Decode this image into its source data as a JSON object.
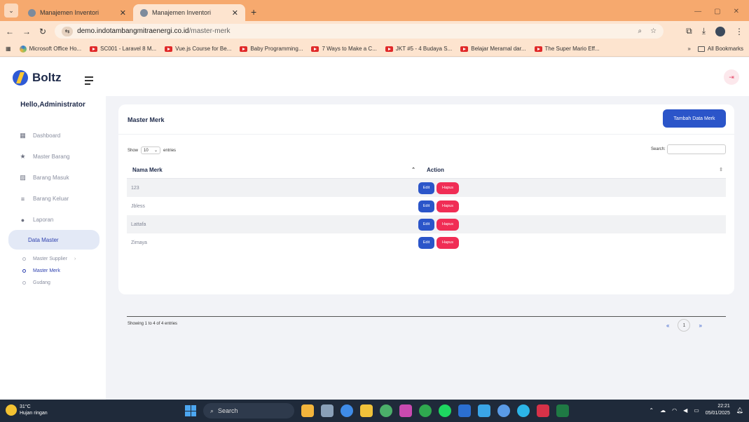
{
  "browser": {
    "tabs": [
      {
        "title": "Manajemen Inventori"
      },
      {
        "title": "Manajemen Inventori"
      }
    ],
    "url_host": "demo.indotambangmitraenergi.co.id",
    "url_path": "/master-merk",
    "bookmarks": [
      {
        "label": "Microsoft Office Ho...",
        "icon": "microsoft-icon"
      },
      {
        "label": "SC001 - Laravel 8 M...",
        "icon": "youtube-icon"
      },
      {
        "label": "Vue.js Course for Be...",
        "icon": "youtube-icon"
      },
      {
        "label": "Baby Programming...",
        "icon": "youtube-icon"
      },
      {
        "label": "7 Ways to Make a C...",
        "icon": "youtube-icon"
      },
      {
        "label": "JKT #5 - 4 Budaya S...",
        "icon": "youtube-icon"
      },
      {
        "label": "Belajar Meramal dar...",
        "icon": "youtube-icon"
      },
      {
        "label": "The Super Mario Eff...",
        "icon": "youtube-icon"
      }
    ],
    "all_bookmarks": "All Bookmarks",
    "more": "»"
  },
  "sidebar": {
    "brand": "Boltz",
    "greeting": "Hello,Administrator",
    "items": [
      {
        "label": "Dashboard",
        "icon": "dashboard-icon"
      },
      {
        "label": "Master Barang",
        "icon": "star-icon"
      },
      {
        "label": "Barang Masuk",
        "icon": "inbox-icon"
      },
      {
        "label": "Barang Keluar",
        "icon": "list-icon"
      },
      {
        "label": "Laporan",
        "icon": "report-icon"
      }
    ],
    "active_group": "Data Master",
    "sub_items": [
      {
        "label": "Master Supplier"
      },
      {
        "label": "Master Merk"
      },
      {
        "label": "Gudang"
      }
    ]
  },
  "page": {
    "card_title": "Master Merk",
    "add_button": "Tambah Data Merk",
    "show_label": "Show",
    "entries_label": "entries",
    "page_size": "10",
    "search_label": "Search:",
    "columns": [
      "Nama Merk",
      "Action"
    ],
    "rows": [
      {
        "name": "123"
      },
      {
        "name": "Jbless"
      },
      {
        "name": "Lattafa"
      },
      {
        "name": "Zimaya"
      }
    ],
    "edit_label": "Edit",
    "delete_label": "Hapus",
    "info": "Showing 1 to 4 of 4 entries",
    "prev": "«",
    "current_page": "1",
    "next": "»"
  },
  "taskbar": {
    "temperature": "31°C",
    "weather": "Hujan ringan",
    "search": "Search",
    "time": "22:21",
    "date": "05/01/2025"
  },
  "colors": {
    "primary": "#2b55c9",
    "danger": "#f02d55",
    "browser_frame": "#f6a96e"
  }
}
